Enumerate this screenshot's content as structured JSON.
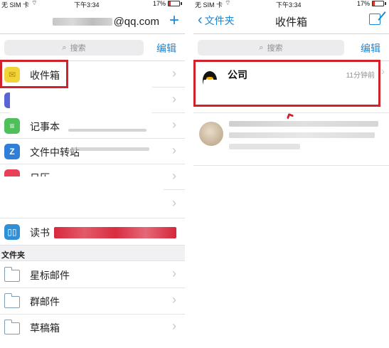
{
  "status": {
    "carrier": "无 SIM 卡",
    "wifi_icon": "wifi-icon",
    "time": "下午3:34",
    "battery": "17%",
    "battery_level": 0.17,
    "battery_color": "#e2332b"
  },
  "left": {
    "account_suffix": "@qq.com",
    "add_icon": "plus-icon",
    "add_label": "+",
    "search_placeholder": "搜索",
    "edit_label": "编辑",
    "rows": [
      {
        "label": "收件箱",
        "icon": "inbox-icon",
        "color": "#f2d43a",
        "glyph": "✉"
      },
      {
        "label": "",
        "icon": "sent-icon",
        "color": "#5b62d6",
        "glyph": ""
      },
      {
        "label": "记事本",
        "icon": "notepad-icon",
        "color": "#4fbf59",
        "glyph": "≡"
      },
      {
        "label": "文件中转站",
        "icon": "transfer-station-icon",
        "color": "#2f7fd9",
        "glyph": "Z"
      },
      {
        "label": "日历",
        "icon": "calendar-icon",
        "color": "#e8405a",
        "glyph": ""
      },
      {
        "label": "",
        "icon": "",
        "color": "",
        "glyph": ""
      },
      {
        "label": "读书",
        "icon": "book-icon",
        "color": "#2f8fd9",
        "glyph": "▯▯"
      }
    ],
    "section_header": "文件夹",
    "folders": [
      {
        "label": "星标邮件",
        "icon": "folder-icon"
      },
      {
        "label": "群邮件",
        "icon": "folder-icon"
      },
      {
        "label": "草稿箱",
        "icon": "folder-icon"
      }
    ],
    "arrow_icon": "chevron-right-icon"
  },
  "right": {
    "back_label": "文件夹",
    "back_icon": "chevron-left-icon",
    "title": "收件箱",
    "compose_icon": "compose-icon",
    "search_placeholder": "搜索",
    "edit_label": "编辑",
    "mails": [
      {
        "sender": "公司",
        "time": "11分钟前",
        "avatar": "qq-penguin-avatar"
      },
      {
        "sender": "",
        "time": "",
        "avatar": "user-photo-avatar"
      }
    ]
  },
  "colors": {
    "accent": "#1a86d4",
    "highlight_border": "#d0222a"
  }
}
